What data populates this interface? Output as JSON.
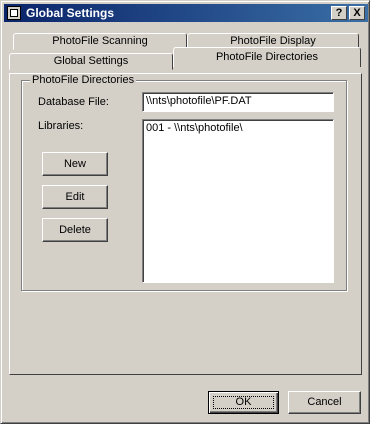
{
  "window": {
    "title": "Global Settings",
    "help_label": "?",
    "close_label": "X"
  },
  "tabs": {
    "back_row": [
      "PhotoFile Scanning",
      "PhotoFile Display"
    ],
    "front_row": [
      "Global Settings",
      "PhotoFile Directories"
    ],
    "active": "PhotoFile Directories"
  },
  "directories": {
    "group_label": "PhotoFile Directories",
    "database_label": "Database File:",
    "database_value": "\\\\nts\\photofile\\PF.DAT",
    "libraries_label": "Libraries:",
    "libraries": [
      "001 - \\\\nts\\photofile\\"
    ],
    "new_label": "New",
    "edit_label": "Edit",
    "delete_label": "Delete"
  },
  "footer": {
    "ok_label": "OK",
    "cancel_label": "Cancel"
  }
}
